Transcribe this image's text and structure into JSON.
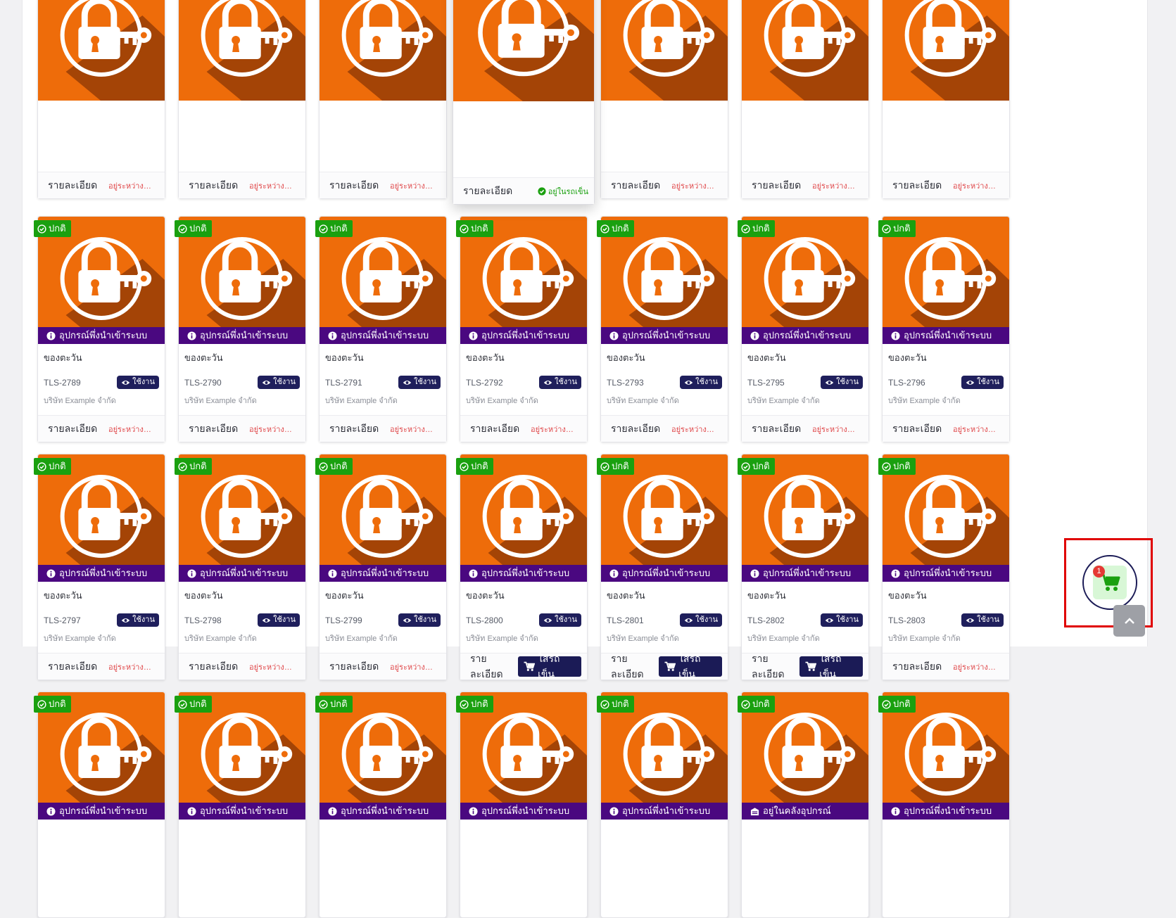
{
  "labels": {
    "details": "รายละเอียด",
    "status_normal": "ปกติ",
    "in_use": "ใช้งาน",
    "banner_registered": "อุปกรณ์พึ่งนำเข้าระบบ",
    "banner_in_warehouse": "อยู่ในคลังอุปกรณ์",
    "in_progress": "อยู่ระหว่างทำเ...",
    "in_cart": "อยู่ในรถเข็น",
    "add_to_cart": "ใส่รถเข็น",
    "owner": "ของตะวัน",
    "company": "บริษัท Example จำกัด"
  },
  "colors": {
    "thumb_orange": "#ee6c0a",
    "banner_purple": "#4a0880",
    "badge_green": "#1aa00f",
    "navy": "#1b1b56",
    "in_progress_red": "#e0494b"
  },
  "cart": {
    "count": "1",
    "icon": "cart-icon"
  },
  "rows": [
    {
      "partial": true,
      "cards": [
        {
          "code": "",
          "footer": "in_progress"
        },
        {
          "code": "",
          "footer": "in_progress"
        },
        {
          "code": "",
          "footer": "in_progress"
        },
        {
          "code": "",
          "footer": "in_cart",
          "raised": true
        },
        {
          "code": "",
          "footer": "in_progress"
        },
        {
          "code": "",
          "footer": "in_progress"
        },
        {
          "code": "",
          "footer": "in_progress"
        }
      ]
    },
    {
      "cards": [
        {
          "code": "TLS-2789",
          "banner": "banner_registered",
          "footer": "in_progress"
        },
        {
          "code": "TLS-2790",
          "banner": "banner_registered",
          "footer": "in_progress"
        },
        {
          "code": "TLS-2791",
          "banner": "banner_registered",
          "footer": "in_progress"
        },
        {
          "code": "TLS-2792",
          "banner": "banner_registered",
          "footer": "in_progress"
        },
        {
          "code": "TLS-2793",
          "banner": "banner_registered",
          "footer": "in_progress"
        },
        {
          "code": "TLS-2795",
          "banner": "banner_registered",
          "footer": "in_progress"
        },
        {
          "code": "TLS-2796",
          "banner": "banner_registered",
          "footer": "in_progress"
        }
      ]
    },
    {
      "cards": [
        {
          "code": "TLS-2797",
          "banner": "banner_registered",
          "footer": "in_progress"
        },
        {
          "code": "TLS-2798",
          "banner": "banner_registered",
          "footer": "in_progress"
        },
        {
          "code": "TLS-2799",
          "banner": "banner_registered",
          "footer": "in_progress"
        },
        {
          "code": "TLS-2800",
          "banner": "banner_registered",
          "footer": "add_to_cart"
        },
        {
          "code": "TLS-2801",
          "banner": "banner_registered",
          "footer": "add_to_cart"
        },
        {
          "code": "TLS-2802",
          "banner": "banner_registered",
          "footer": "add_to_cart"
        },
        {
          "code": "TLS-2803",
          "banner": "banner_registered",
          "footer": "in_progress"
        }
      ]
    },
    {
      "cards": [
        {
          "code": "",
          "banner": "banner_registered"
        },
        {
          "code": "",
          "banner": "banner_registered"
        },
        {
          "code": "",
          "banner": "banner_registered"
        },
        {
          "code": "",
          "banner": "banner_registered"
        },
        {
          "code": "",
          "banner": "banner_registered"
        },
        {
          "code": "",
          "banner": "banner_in_warehouse"
        },
        {
          "code": "",
          "banner": "banner_registered"
        }
      ]
    }
  ]
}
